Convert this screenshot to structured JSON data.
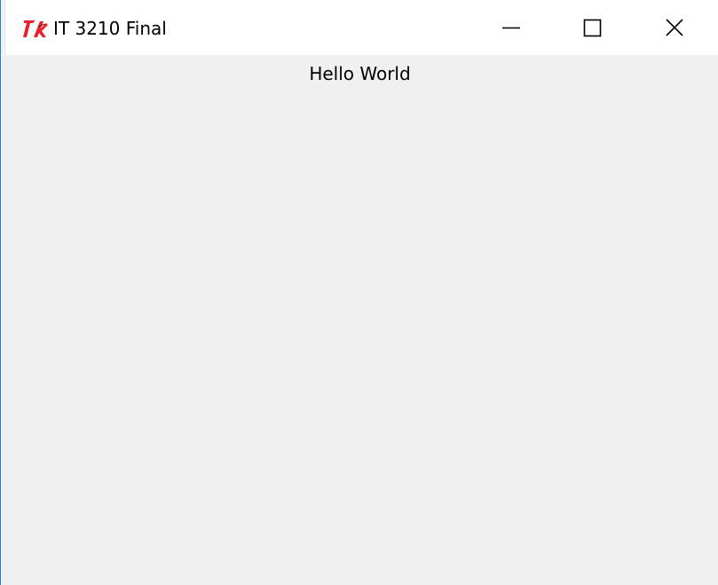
{
  "window": {
    "title": "IT 3210 Final",
    "icon": "tk-feather-icon",
    "controls": {
      "minimize": "minimize-icon",
      "maximize": "maximize-icon",
      "close": "close-icon"
    }
  },
  "content": {
    "label": "Hello World"
  },
  "colors": {
    "titlebar_bg": "#ffffff",
    "client_bg": "#f0f0f0",
    "border_accent": "#1883d7",
    "icon_red": "#e8232b"
  }
}
